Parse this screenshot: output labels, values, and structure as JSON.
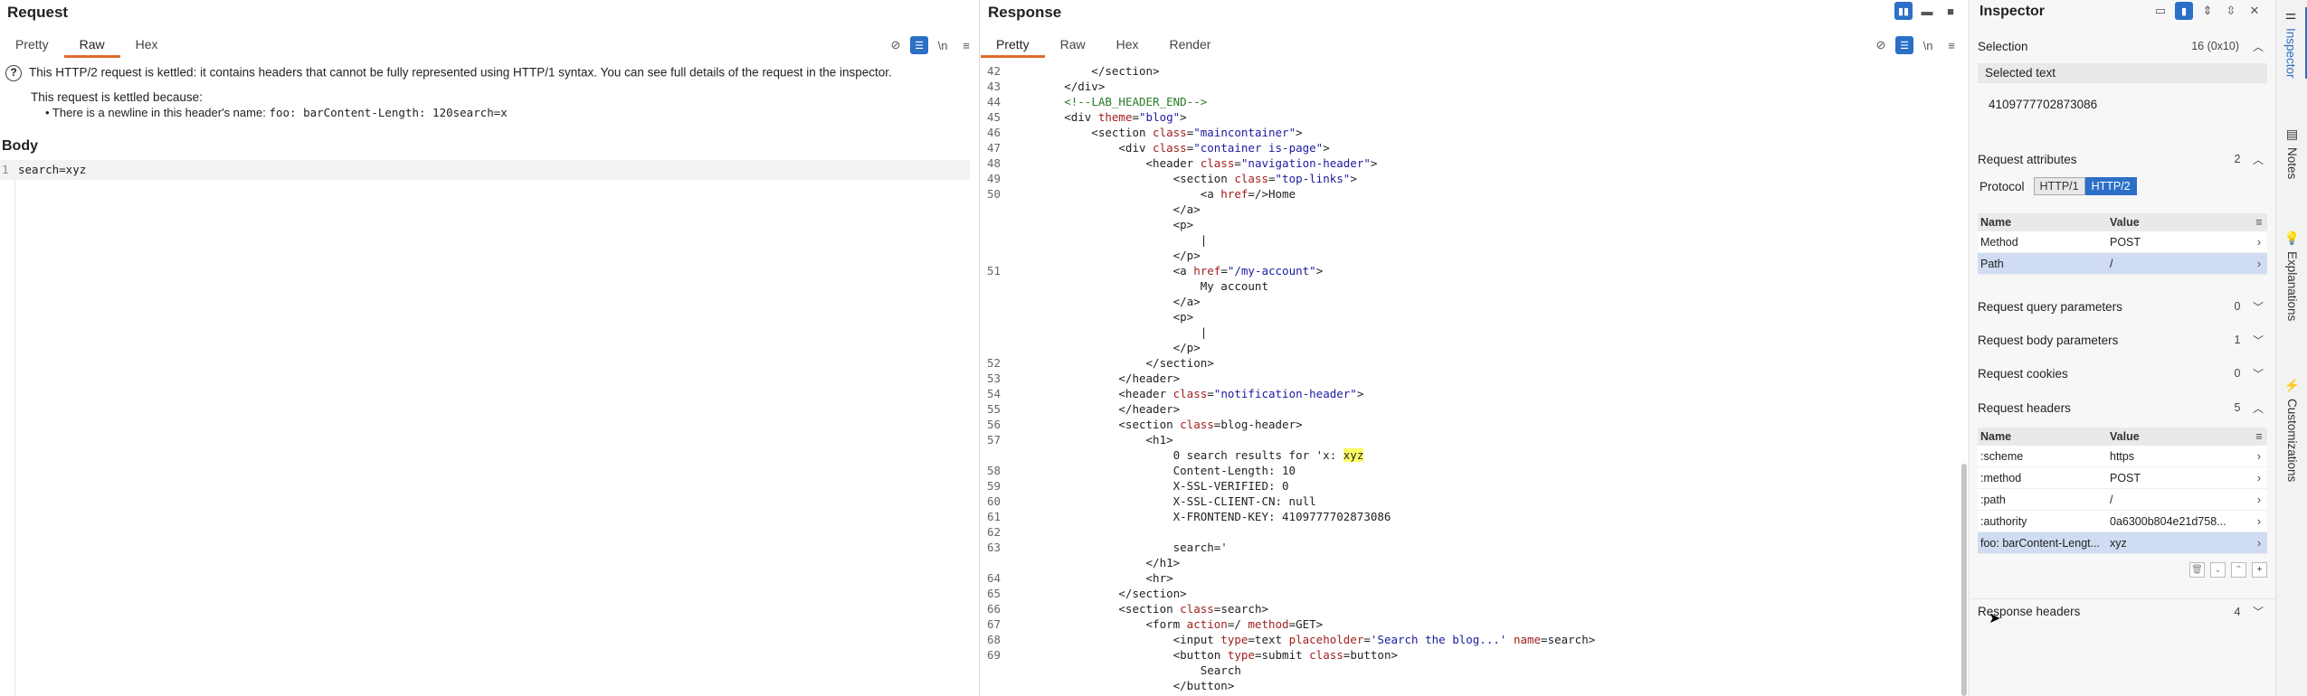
{
  "request": {
    "title": "Request",
    "tabs": [
      "Pretty",
      "Raw",
      "Hex"
    ],
    "active_tab": "Raw",
    "warning_text": "This HTTP/2 request is kettled: it contains headers that cannot be fully represented using HTTP/1 syntax. You can see full details of the request in the inspector.",
    "warning_reason_title": "This request is kettled because:",
    "warning_reason_prefix": "• There is a newline in this header's name: ",
    "warning_reason_code": "foo: barContent-Length: 120search=x",
    "body_title": "Body",
    "body_line_number": "1",
    "body_text": "search=xyz",
    "icon_wrap": "\\n"
  },
  "response": {
    "title": "Response",
    "tabs": [
      "Pretty",
      "Raw",
      "Hex",
      "Render"
    ],
    "active_tab": "Pretty",
    "icon_wrap": "\\n",
    "lines": [
      {
        "n": "42",
        "html": "            &lt;/section&gt;"
      },
      {
        "n": "43",
        "html": "        &lt;/div&gt;"
      },
      {
        "n": "44",
        "html": "        <span class=\"cmt\">&lt;!--LAB_HEADER_END--&gt;</span>"
      },
      {
        "n": "45",
        "html": "        &lt;div <span class=\"attr\">theme</span>=<span class=\"str\">\"blog\"</span>&gt;"
      },
      {
        "n": "46",
        "html": "            &lt;section <span class=\"attr\">class</span>=<span class=\"str\">\"maincontainer\"</span>&gt;"
      },
      {
        "n": "47",
        "html": "                &lt;div <span class=\"attr\">class</span>=<span class=\"str\">\"container is-page\"</span>&gt;"
      },
      {
        "n": "48",
        "html": "                    &lt;header <span class=\"attr\">class</span>=<span class=\"str\">\"navigation-header\"</span>&gt;"
      },
      {
        "n": "49",
        "html": "                        &lt;section <span class=\"attr\">class</span>=<span class=\"str\">\"top-links\"</span>&gt;"
      },
      {
        "n": "50",
        "html": "                            &lt;a <span class=\"attr\">href</span>=/&gt;Home"
      },
      {
        "n": "",
        "html": "                        &lt;/a&gt;"
      },
      {
        "n": "",
        "html": "                        &lt;p&gt;"
      },
      {
        "n": "",
        "html": "                            |"
      },
      {
        "n": "",
        "html": "                        &lt;/p&gt;"
      },
      {
        "n": "51",
        "html": "                        &lt;a <span class=\"attr\">href</span>=<span class=\"str\">\"/my-account\"</span>&gt;"
      },
      {
        "n": "",
        "html": "                            My account"
      },
      {
        "n": "",
        "html": "                        &lt;/a&gt;"
      },
      {
        "n": "",
        "html": "                        &lt;p&gt;"
      },
      {
        "n": "",
        "html": "                            |"
      },
      {
        "n": "",
        "html": "                        &lt;/p&gt;"
      },
      {
        "n": "52",
        "html": "                    &lt;/section&gt;"
      },
      {
        "n": "53",
        "html": "                &lt;/header&gt;"
      },
      {
        "n": "54",
        "html": "                &lt;header <span class=\"attr\">class</span>=<span class=\"str\">\"notification-header\"</span>&gt;"
      },
      {
        "n": "55",
        "html": "                &lt;/header&gt;"
      },
      {
        "n": "56",
        "html": "                &lt;section <span class=\"attr\">class</span>=blog-header&gt;"
      },
      {
        "n": "57",
        "html": "                    &lt;h1&gt;"
      },
      {
        "n": "",
        "html": "                        0 search results for 'x: <span class=\"hl\">xyz</span>"
      },
      {
        "n": "58",
        "html": "                        Content-Length: 10"
      },
      {
        "n": "59",
        "html": "                        X-SSL-VERIFIED: 0"
      },
      {
        "n": "60",
        "html": "                        X-SSL-CLIENT-CN: null"
      },
      {
        "n": "61",
        "html": "                        X-FRONTEND-KEY: 4109777702873086"
      },
      {
        "n": "62",
        "html": ""
      },
      {
        "n": "63",
        "html": "                        search='"
      },
      {
        "n": "",
        "html": "                    &lt;/h1&gt;"
      },
      {
        "n": "64",
        "html": "                    &lt;hr&gt;"
      },
      {
        "n": "65",
        "html": "                &lt;/section&gt;"
      },
      {
        "n": "66",
        "html": "                &lt;section <span class=\"attr\">class</span>=search&gt;"
      },
      {
        "n": "67",
        "html": "                    &lt;form <span class=\"attr\">action</span>=/ <span class=\"attr\">method</span>=GET&gt;"
      },
      {
        "n": "68",
        "html": "                        &lt;input <span class=\"attr\">type</span>=text <span class=\"attr\">placeholder</span>=<span class=\"str\">'Search the blog...'</span> <span class=\"attr\">name</span>=search&gt;"
      },
      {
        "n": "69",
        "html": "                        &lt;button <span class=\"attr\">type</span>=submit <span class=\"attr\">class</span>=button&gt;"
      },
      {
        "n": "",
        "html": "                            Search"
      },
      {
        "n": "",
        "html": "                        &lt;/button&gt;"
      }
    ]
  },
  "inspector": {
    "title": "Inspector",
    "selection": {
      "label": "Selection",
      "count": "16 (0x10)"
    },
    "selected_text_label": "Selected text",
    "selected_text_value": "4109777702873086",
    "request_attributes": {
      "label": "Request attributes",
      "count": "2"
    },
    "protocol_label": "Protocol",
    "protocol_options": [
      "HTTP/1",
      "HTTP/2"
    ],
    "protocol_selected": "HTTP/2",
    "table_headers": {
      "name": "Name",
      "value": "Value"
    },
    "attributes_rows": [
      {
        "name": "Method",
        "value": "POST"
      },
      {
        "name": "Path",
        "value": "/"
      }
    ],
    "request_query_parameters": {
      "label": "Request query parameters",
      "count": "0"
    },
    "request_body_parameters": {
      "label": "Request body parameters",
      "count": "1"
    },
    "request_cookies": {
      "label": "Request cookies",
      "count": "0"
    },
    "request_headers": {
      "label": "Request headers",
      "count": "5"
    },
    "header_rows": [
      {
        "name": ":scheme",
        "value": "https"
      },
      {
        "name": ":method",
        "value": "POST"
      },
      {
        "name": ":path",
        "value": "/"
      },
      {
        "name": ":authority",
        "value": "0a6300b804e21d758..."
      },
      {
        "name": "foo: barContent-Lengt...",
        "value": "xyz"
      }
    ],
    "response_headers": {
      "label": "Response headers",
      "count": "4"
    }
  },
  "rail": {
    "items": [
      {
        "label": "Inspector",
        "icon": "sliders-icon"
      },
      {
        "label": "Notes",
        "icon": "note-icon"
      },
      {
        "label": "Explanations",
        "icon": "lightbulb-icon"
      },
      {
        "label": "Customizations",
        "icon": "lightning-icon"
      }
    ]
  },
  "colors": {
    "accent": "#2b6fc7",
    "tab_underline": "#e06c2e",
    "highlight": "#ffff66"
  }
}
